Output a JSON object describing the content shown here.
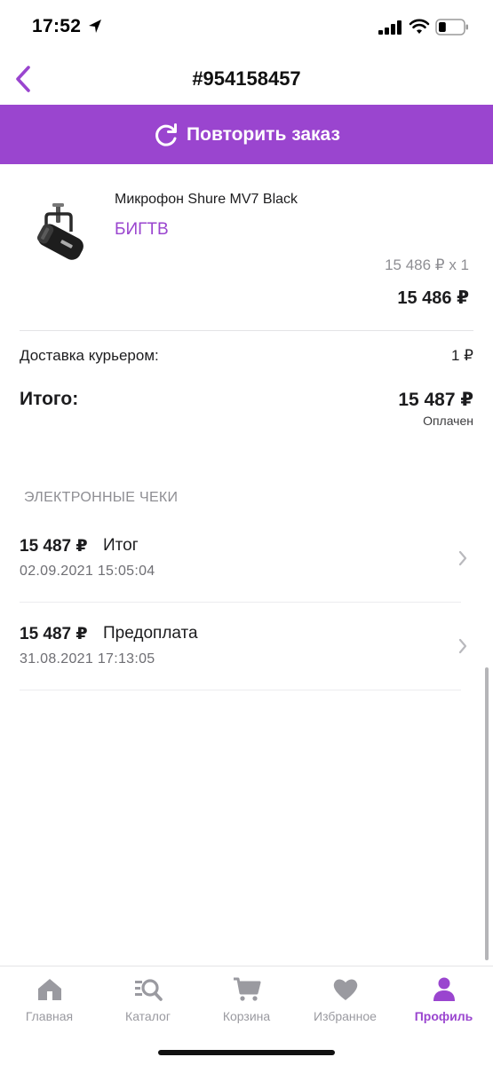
{
  "status_bar": {
    "time": "17:52",
    "icons": [
      "location-arrow-icon",
      "signal-icon",
      "wifi-icon",
      "battery-icon"
    ],
    "battery_level": 0.3
  },
  "header": {
    "title": "#954158457",
    "back_icon": "chevron-left-icon"
  },
  "repeat_order": {
    "label": "Повторить заказ",
    "icon": "refresh-icon"
  },
  "product": {
    "name": "Микрофон Shure MV7 Black",
    "seller": "БИГТВ",
    "unit_price": "15 486 ₽ x 1",
    "total": "15 486 ₽"
  },
  "summary": {
    "delivery_label": "Доставка курьером:",
    "delivery_price": "1 ₽",
    "total_label": "Итого:",
    "total_value": "15 487 ₽",
    "status": "Оплачен"
  },
  "receipts": {
    "header": "ЭЛЕКТРОННЫЕ ЧЕКИ",
    "items": [
      {
        "amount": "15 487 ₽",
        "type": "Итог",
        "date": "02.09.2021 15:05:04"
      },
      {
        "amount": "15 487 ₽",
        "type": "Предоплата",
        "date": "31.08.2021 17:13:05"
      }
    ]
  },
  "tabbar": {
    "items": [
      {
        "label": "Главная",
        "icon": "home-icon",
        "active": false
      },
      {
        "label": "Каталог",
        "icon": "catalog-search-icon",
        "active": false
      },
      {
        "label": "Корзина",
        "icon": "cart-icon",
        "active": false
      },
      {
        "label": "Избранное",
        "icon": "heart-icon",
        "active": false
      },
      {
        "label": "Профиль",
        "icon": "profile-icon",
        "active": true
      }
    ]
  },
  "colors": {
    "accent": "#9a45cf",
    "inactive_tab": "#9a9aa0",
    "muted_text": "#8e8e93"
  }
}
